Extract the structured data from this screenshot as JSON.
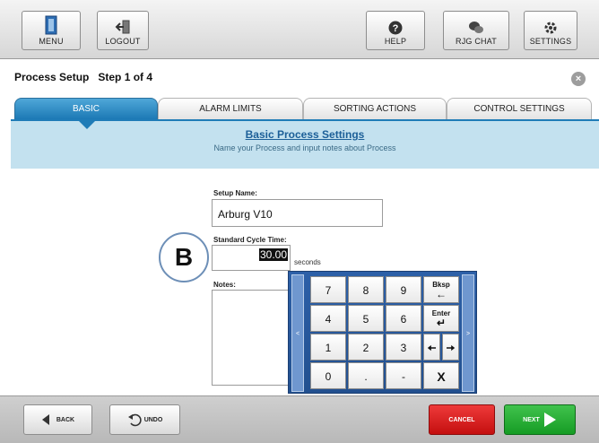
{
  "toolbar": {
    "menu_label": "MENU",
    "logout_label": "LOGOUT",
    "help_label": "HELP",
    "chat_label": "RJG CHAT",
    "settings_label": "SETTINGS"
  },
  "header": {
    "title": "Process Setup   Step 1 of 4",
    "close_glyph": "×"
  },
  "tabs": [
    {
      "label": "BASIC",
      "active": true
    },
    {
      "label": "ALARM LIMITS",
      "active": false
    },
    {
      "label": "SORTING ACTIONS",
      "active": false
    },
    {
      "label": "CONTROL SETTINGS",
      "active": false
    }
  ],
  "banner": {
    "title": "Basic Process Settings",
    "subtitle": "Name your Process and input notes about Process"
  },
  "form": {
    "setup_name_label": "Setup Name:",
    "setup_name_value": "Arburg V10",
    "cycle_time_label": "Standard Cycle Time:",
    "cycle_time_value": "30.00",
    "cycle_time_units": "seconds",
    "notes_label": "Notes:"
  },
  "callout": {
    "letter": "B"
  },
  "keypad": {
    "left_arrow": "<",
    "right_arrow": ">",
    "keys": {
      "k7": "7",
      "k8": "8",
      "k9": "9",
      "k4": "4",
      "k5": "5",
      "k6": "6",
      "k1": "1",
      "k2": "2",
      "k3": "3",
      "k0": "0",
      "dot": ".",
      "minus": "-",
      "bksp": "Bksp",
      "enter": "Enter",
      "clear": "X"
    }
  },
  "bottom": {
    "back_label": "BACK",
    "undo_label": "UNDO",
    "cancel_label": "CANCEL",
    "next_label": "NEXT"
  },
  "colors": {
    "accent_blue": "#1f7cb7",
    "banner_bg": "#c3e1ef",
    "cancel_red": "#d41b1b",
    "next_green": "#23a531",
    "keypad_blue": "#2758a0"
  }
}
